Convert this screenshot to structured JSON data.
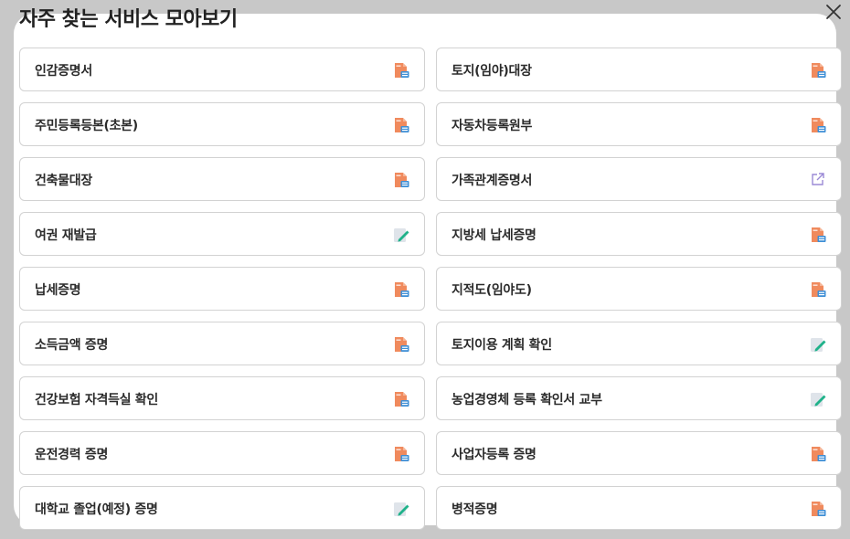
{
  "modal": {
    "title": "자주 찾는 서비스 모아보기"
  },
  "colors": {
    "overlay": "#c8c8c8",
    "card_border": "#d2d2d2",
    "document_icon": "#f08a5d",
    "edit_icon": "#20b28a",
    "external_link_icon": "#9b8ad6"
  },
  "services": [
    {
      "label": "인감증명서",
      "icon": "document-icon"
    },
    {
      "label": "토지(임야)대장",
      "icon": "document-icon"
    },
    {
      "label": "주민등록등본(초본)",
      "icon": "document-icon"
    },
    {
      "label": "자동차등록원부",
      "icon": "document-icon"
    },
    {
      "label": "건축물대장",
      "icon": "document-icon"
    },
    {
      "label": "가족관계증명서",
      "icon": "external-link-icon"
    },
    {
      "label": "여권 재발급",
      "icon": "edit-icon"
    },
    {
      "label": "지방세 납세증명",
      "icon": "document-icon"
    },
    {
      "label": "납세증명",
      "icon": "document-icon"
    },
    {
      "label": "지적도(임야도)",
      "icon": "document-icon"
    },
    {
      "label": "소득금액 증명",
      "icon": "document-icon"
    },
    {
      "label": "토지이용 계획 확인",
      "icon": "edit-icon"
    },
    {
      "label": "건강보험 자격득실 확인",
      "icon": "document-icon"
    },
    {
      "label": "농업경영체 등록 확인서 교부",
      "icon": "edit-icon"
    },
    {
      "label": "운전경력 증명",
      "icon": "document-icon"
    },
    {
      "label": "사업자등록 증명",
      "icon": "document-icon"
    },
    {
      "label": "대학교 졸업(예정) 증명",
      "icon": "edit-icon"
    },
    {
      "label": "병적증명",
      "icon": "document-icon"
    }
  ]
}
